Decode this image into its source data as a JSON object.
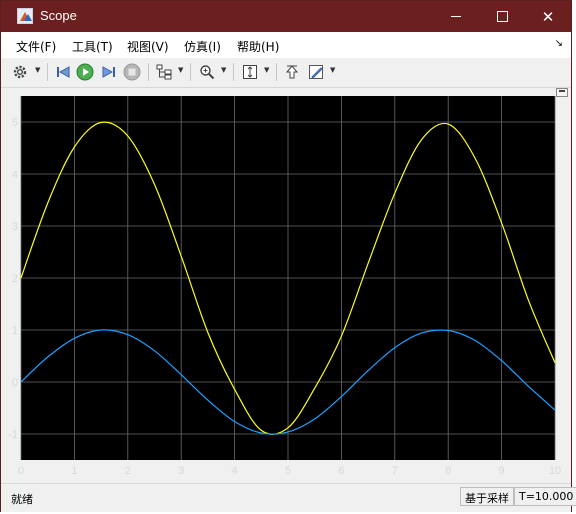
{
  "window": {
    "title": "Scope"
  },
  "menu": [
    "文件(F)",
    "工具(T)",
    "视图(V)",
    "仿真(I)",
    "帮助(H)"
  ],
  "toolbar": {
    "icons": [
      "gear-icon",
      "step-back-icon",
      "run-icon",
      "step-forward-icon",
      "stop-icon",
      "signal-hierarchy-icon",
      "zoom-icon",
      "scale-axes-icon",
      "highlight-block-icon",
      "style-icon"
    ]
  },
  "colors": {
    "titlebar": "#6b1f1f",
    "axes_bg": "#000000",
    "grid": "#6a6a6a",
    "series1": "#ffff14",
    "series2": "#1ea0ff"
  },
  "chart_data": {
    "type": "line",
    "title": "",
    "xlabel": "",
    "ylabel": "",
    "xlim": [
      0,
      10
    ],
    "ylim": [
      -1.5,
      5.5
    ],
    "xticks": [
      "0",
      "1",
      "2",
      "3",
      "4",
      "5",
      "6",
      "7",
      "8",
      "9",
      "10"
    ],
    "yticks": [
      "-1",
      "0",
      "1",
      "2",
      "3",
      "4",
      "5"
    ],
    "grid": true,
    "series": [
      {
        "color": "#ffff14",
        "x": [
          0,
          0.5,
          1,
          1.5,
          2,
          2.5,
          3,
          3.5,
          4,
          4.5,
          5,
          5.5,
          6,
          6.5,
          7,
          7.5,
          8,
          8.5,
          9,
          9.5,
          10
        ],
        "y": [
          2.0,
          3.44,
          4.52,
          4.99,
          4.73,
          3.8,
          2.42,
          0.95,
          -0.14,
          -0.93,
          -0.88,
          -0.12,
          0.88,
          2.28,
          3.63,
          4.66,
          4.96,
          4.31,
          3.06,
          1.58,
          0.37
        ]
      },
      {
        "color": "#1ea0ff",
        "x": [
          0,
          0.5,
          1,
          1.5,
          2,
          2.5,
          3,
          3.5,
          4,
          4.5,
          5,
          5.5,
          6,
          6.5,
          7,
          7.5,
          8,
          8.5,
          9,
          9.5,
          10
        ],
        "y": [
          0.0,
          0.48,
          0.84,
          1.0,
          0.91,
          0.6,
          0.14,
          -0.35,
          -0.76,
          -0.98,
          -0.96,
          -0.71,
          -0.28,
          0.22,
          0.66,
          0.94,
          0.99,
          0.8,
          0.41,
          -0.08,
          -0.54
        ]
      }
    ]
  },
  "status": {
    "left": "就绪",
    "mode": "基于采样",
    "time": "T=10.000"
  }
}
